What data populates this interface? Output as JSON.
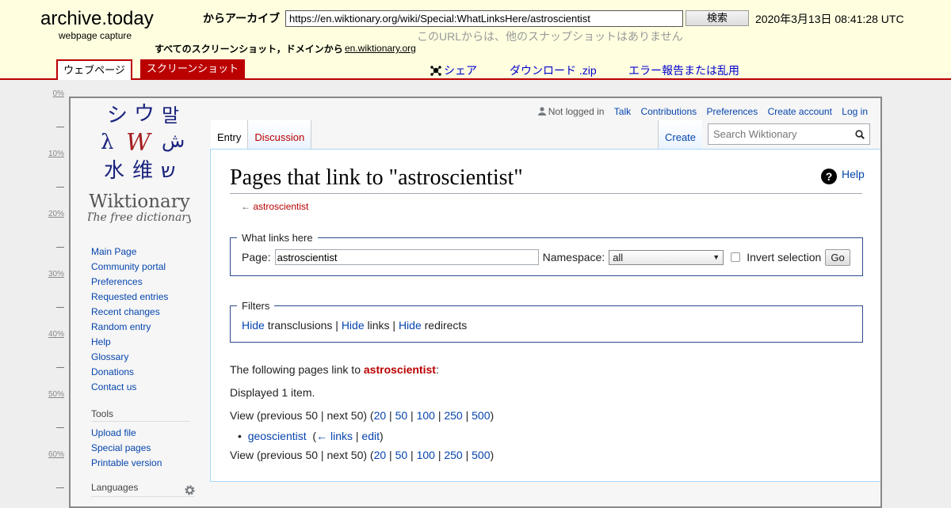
{
  "archive": {
    "title": "archive.today",
    "subtitle": "webpage capture",
    "from_label": "からアーカイブ",
    "url": "https://en.wiktionary.org/wiki/Special:WhatLinksHere/astroscientist",
    "search_label": "検索",
    "date": "2020年3月13日 08:41:28 UTC",
    "no_snapshots": "このURLからは、他のスナップショットはありません",
    "all_screenshots": "すべてのスクリーンショット，ドメインから",
    "domain": "en.wiktionary.org",
    "tab_webpage": "ウェブページ",
    "tab_screenshot": "スクリーンショット",
    "share": "シェア",
    "download": "ダウンロード .zip",
    "report": "エラー報告または乱用"
  },
  "ruler": [
    "0%",
    "10%",
    "20%",
    "30%",
    "40%",
    "50%",
    "60%"
  ],
  "wiki": {
    "logo_name": "Wiktionary",
    "logo_tagline": "The free dictionary",
    "logo_glyphs": [
      "シ",
      "ウ",
      "말",
      "λ",
      "W",
      "ش",
      "水",
      "维",
      "ש"
    ],
    "personal": {
      "not_logged_in": "Not logged in",
      "talk": "Talk",
      "contributions": "Contributions",
      "preferences": "Preferences",
      "create_account": "Create account",
      "log_in": "Log in"
    },
    "tabs": {
      "entry": "Entry",
      "discussion": "Discussion",
      "create": "Create"
    },
    "search_placeholder": "Search Wiktionary",
    "nav": [
      "Main Page",
      "Community portal",
      "Preferences",
      "Requested entries",
      "Recent changes",
      "Random entry",
      "Help",
      "Glossary",
      "Donations",
      "Contact us"
    ],
    "tools_heading": "Tools",
    "tools": [
      "Upload file",
      "Special pages",
      "Printable version"
    ],
    "languages_heading": "Languages"
  },
  "page": {
    "title": "Pages that link to \"astroscientist\"",
    "help": "Help",
    "back_arrow": "←",
    "back_link": "astroscientist",
    "fs1_legend": "What links here",
    "page_label": "Page:",
    "page_value": "astroscientist",
    "namespace_label": "Namespace:",
    "namespace_value": "all",
    "invert_label": "Invert selection",
    "go": "Go",
    "fs2_legend": "Filters",
    "filters": {
      "hide": "Hide",
      "transclusions": "transclusions",
      "links": "links",
      "redirects": "redirects",
      "sep": "|"
    },
    "intro_prefix": "The following pages link to",
    "intro_target": "astroscientist",
    "intro_suffix": ":",
    "displayed": "Displayed 1 item.",
    "view_prefix": "View (previous 50 | next 50) (",
    "view_counts": [
      "20",
      "50",
      "100",
      "250",
      "500"
    ],
    "view_suffix": ")",
    "result": {
      "name": "geoscientist",
      "links": "← links",
      "edit": "edit"
    }
  }
}
